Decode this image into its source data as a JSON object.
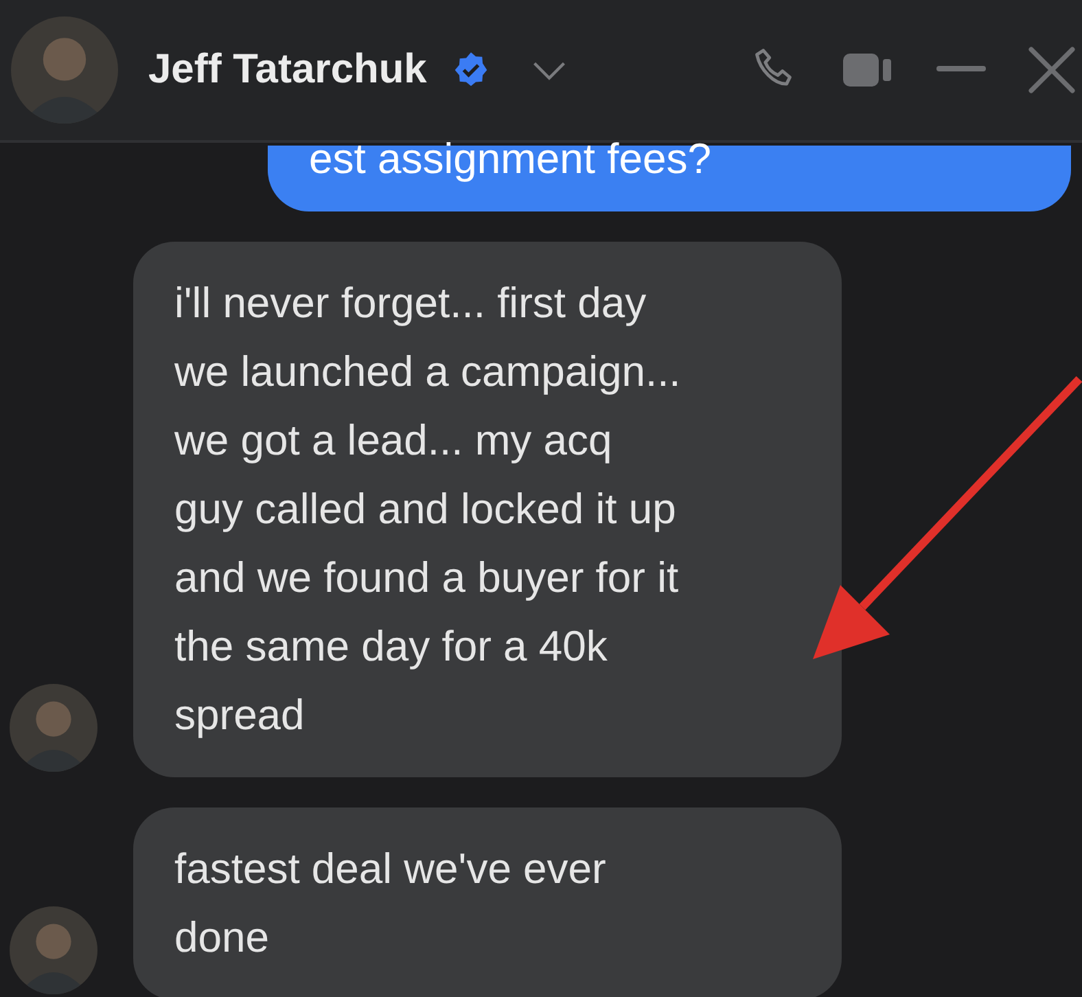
{
  "header": {
    "name": "Jeff Tatarchuk",
    "verified": true
  },
  "messages": [
    {
      "kind": "sent",
      "text": "est assignment fees?"
    },
    {
      "kind": "received",
      "text": "i'll never forget... first day\nwe launched a campaign...\nwe got a lead... my acq\nguy called and locked it up\nand we found a buyer for it\nthe same day for a 40k\nspread"
    },
    {
      "kind": "received",
      "text": "fastest deal we've ever\ndone"
    }
  ],
  "annotations": [
    {
      "kind": "arrow"
    }
  ]
}
